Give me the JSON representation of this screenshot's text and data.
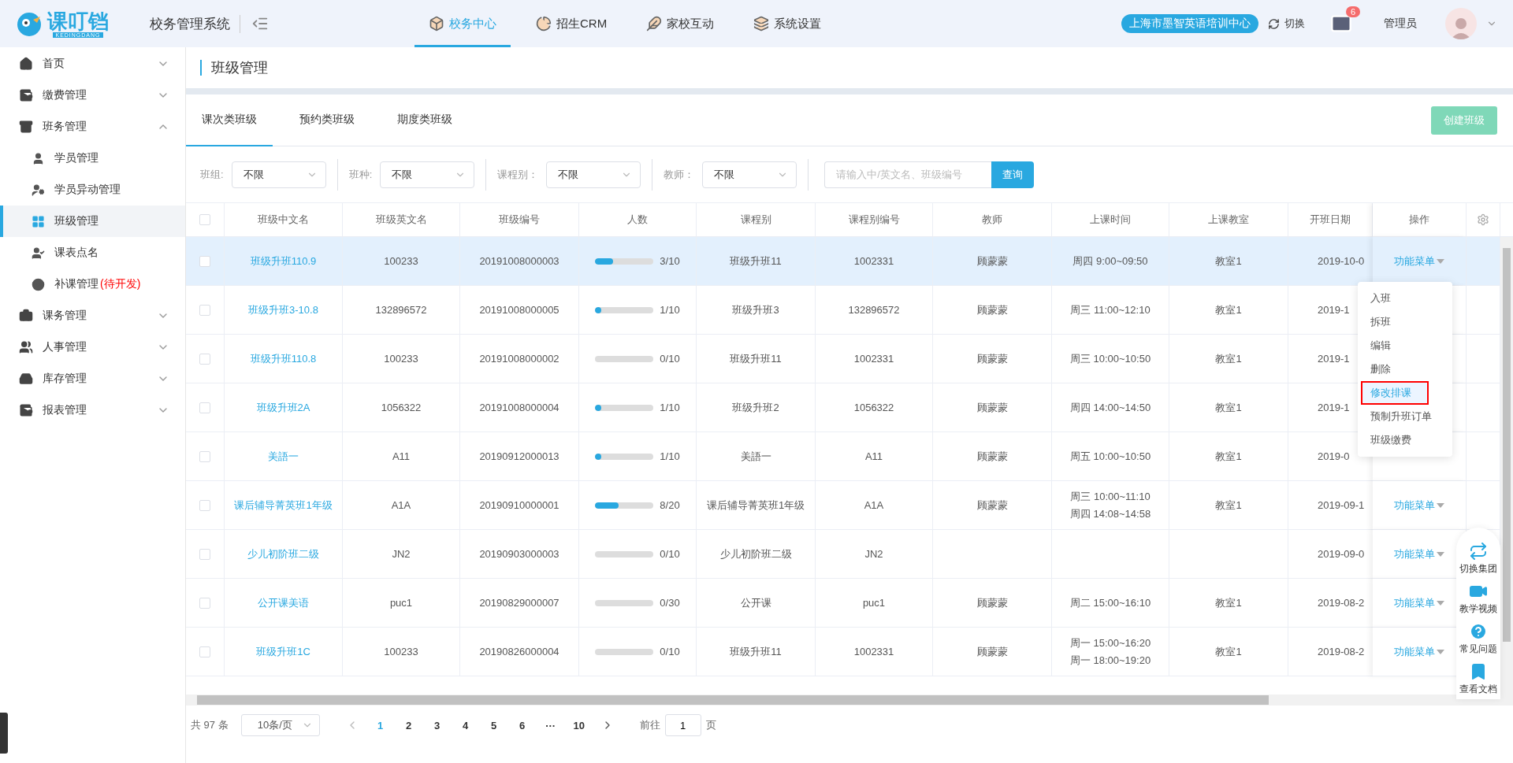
{
  "header": {
    "logo_text": "课叮铛",
    "logo_subtext": "KEDINGDANG",
    "system_name": "校务管理系统",
    "nav": [
      {
        "label": "校务中心",
        "selected": true
      },
      {
        "label": "招生CRM",
        "selected": false
      },
      {
        "label": "家校互动",
        "selected": false
      },
      {
        "label": "系统设置",
        "selected": false
      }
    ],
    "organization": "上海市墨智英语培训中心",
    "switch_label": "切换",
    "mail_badge": "6",
    "user_name": "管理员"
  },
  "sidebar": {
    "items": [
      {
        "label": "首页",
        "expanded": false
      },
      {
        "label": "缴费管理",
        "expanded": false
      },
      {
        "label": "班务管理",
        "expanded": true,
        "children": [
          {
            "label": "学员管理",
            "selected": false
          },
          {
            "label": "学员异动管理",
            "selected": false
          },
          {
            "label": "班级管理",
            "selected": true
          },
          {
            "label": "课表点名",
            "selected": false
          },
          {
            "label": "补课管理",
            "tag": "(待开发)",
            "selected": false
          }
        ]
      },
      {
        "label": "课务管理",
        "expanded": false
      },
      {
        "label": "人事管理",
        "expanded": false
      },
      {
        "label": "库存管理",
        "expanded": false
      },
      {
        "label": "报表管理",
        "expanded": false
      }
    ]
  },
  "page_title": "班级管理",
  "tabs": [
    {
      "label": "课次类班级",
      "selected": true
    },
    {
      "label": "预约类班级",
      "selected": false
    },
    {
      "label": "期度类班级",
      "selected": false
    }
  ],
  "create_button": "创建班级",
  "filters": [
    {
      "label": "班组:",
      "value": "不限"
    },
    {
      "label": "班种:",
      "value": "不限"
    },
    {
      "label": "课程别：",
      "value": "不限"
    },
    {
      "label": "教师：",
      "value": "不限"
    }
  ],
  "search": {
    "placeholder": "请输入中/英文名、班级编号",
    "button": "查询"
  },
  "table": {
    "select_all_checked": false,
    "columns": [
      "班级中文名",
      "班级英文名",
      "班级编号",
      "人数",
      "课程别",
      "课程别编号",
      "教师",
      "上课时间",
      "上课教室",
      "开班日期",
      "操作"
    ],
    "rows": [
      {
        "selected": true,
        "checked": false,
        "name": "班级升班110.9",
        "english_name": "100233",
        "class_no": "20191008000003",
        "headcount": {
          "level": 0.3,
          "text": "3/10"
        },
        "course": "班级升班11",
        "course_no": "1002331",
        "teacher": "顾蒙蒙",
        "times": [
          "周四 9:00~09:50"
        ],
        "room": "教室1",
        "start_date": "2019-10-0",
        "action": "功能菜单"
      },
      {
        "selected": false,
        "checked": false,
        "name": "班级升班3-10.8",
        "english_name": "132896572",
        "class_no": "20191008000005",
        "headcount": {
          "level": 0.1,
          "text": "1/10"
        },
        "course": "班级升班3",
        "course_no": "132896572",
        "teacher": "顾蒙蒙",
        "times": [
          "周三 11:00~12:10"
        ],
        "room": "教室1",
        "start_date": "2019-1"
      },
      {
        "selected": false,
        "checked": false,
        "name": "班级升班110.8",
        "english_name": "100233",
        "class_no": "20191008000002",
        "headcount": {
          "level": 0,
          "text": "0/10"
        },
        "course": "班级升班11",
        "course_no": "1002331",
        "teacher": "顾蒙蒙",
        "times": [
          "周三 10:00~10:50"
        ],
        "room": "教室1",
        "start_date": "2019-1"
      },
      {
        "selected": false,
        "checked": false,
        "name": "班级升班2A",
        "english_name": "1056322",
        "class_no": "20191008000004",
        "headcount": {
          "level": 0.1,
          "text": "1/10"
        },
        "course": "班级升班2",
        "course_no": "1056322",
        "teacher": "顾蒙蒙",
        "times": [
          "周四 14:00~14:50"
        ],
        "room": "教室1",
        "start_date": "2019-1"
      },
      {
        "selected": false,
        "checked": false,
        "name": "美語一",
        "english_name": "A11",
        "class_no": "20190912000013",
        "headcount": {
          "level": 0.1,
          "text": "1/10"
        },
        "course": "美語一",
        "course_no": "A11",
        "teacher": "顾蒙蒙",
        "times": [
          "周五 10:00~10:50"
        ],
        "room": "教室1",
        "start_date": "2019-0"
      },
      {
        "selected": false,
        "checked": false,
        "name": "课后辅导菁英班1年级",
        "english_name": "A1A",
        "class_no": "20190910000001",
        "headcount": {
          "level": 0.4,
          "text": "8/20"
        },
        "course": "课后辅导菁英班1年级",
        "course_no": "A1A",
        "teacher": "顾蒙蒙",
        "times": [
          "周三 10:00~11:10",
          "周四 14:08~14:58"
        ],
        "room": "教室1",
        "start_date": "2019-09-1",
        "action": "功能菜单"
      },
      {
        "selected": false,
        "checked": false,
        "name": "少儿初阶班二级",
        "english_name": "JN2",
        "class_no": "20190903000003",
        "headcount": {
          "level": 0,
          "text": "0/10"
        },
        "course": "少儿初阶班二级",
        "course_no": "JN2",
        "start_date": "2019-09-0",
        "action": "功能菜单"
      },
      {
        "selected": false,
        "checked": false,
        "name": "公开课美语",
        "english_name": "puc1",
        "class_no": "20190829000007",
        "headcount": {
          "level": 0,
          "text": "0/30"
        },
        "course": "公开课",
        "course_no": "puc1",
        "teacher": "顾蒙蒙",
        "times": [
          "周二 15:00~16:10"
        ],
        "room": "教室1",
        "start_date": "2019-08-2",
        "action": "功能菜单"
      },
      {
        "selected": false,
        "checked": false,
        "name": "班级升班1C",
        "english_name": "100233",
        "class_no": "20190826000004",
        "headcount": {
          "level": 0,
          "text": "0/10"
        },
        "course": "班级升班11",
        "course_no": "1002331",
        "teacher": "顾蒙蒙",
        "times": [
          "周一 15:00~16:20",
          "周一 18:00~19:20"
        ],
        "room": "教室1",
        "start_date": "2019-08-2",
        "action": "功能菜单"
      }
    ]
  },
  "action_menu": [
    {
      "label": "入班",
      "selected": false,
      "outlined": false
    },
    {
      "label": "拆班",
      "selected": false,
      "outlined": false
    },
    {
      "label": "编辑",
      "selected": false,
      "outlined": false
    },
    {
      "label": "删除",
      "selected": false,
      "outlined": false
    },
    {
      "label": "修改排课",
      "selected": true,
      "outlined": true
    },
    {
      "label": "预制升班订单",
      "selected": false,
      "outlined": false
    },
    {
      "label": "班级缴费",
      "selected": false,
      "outlined": false
    }
  ],
  "pagination": {
    "total": "共 97 条",
    "page_size": "10条/页",
    "pages": [
      {
        "label": "1",
        "selected": true
      },
      {
        "label": "2",
        "selected": false
      },
      {
        "label": "3",
        "selected": false
      },
      {
        "label": "4",
        "selected": false
      },
      {
        "label": "5",
        "selected": false
      },
      {
        "label": "6",
        "selected": false
      },
      {
        "label": "···",
        "selected": false
      },
      {
        "label": "10",
        "selected": false
      }
    ],
    "goto_label": "前往",
    "goto_value": "1",
    "page_unit": "页"
  },
  "help_panel": [
    "切换集团",
    "教学视频",
    "常见问题",
    "查看文档"
  ]
}
